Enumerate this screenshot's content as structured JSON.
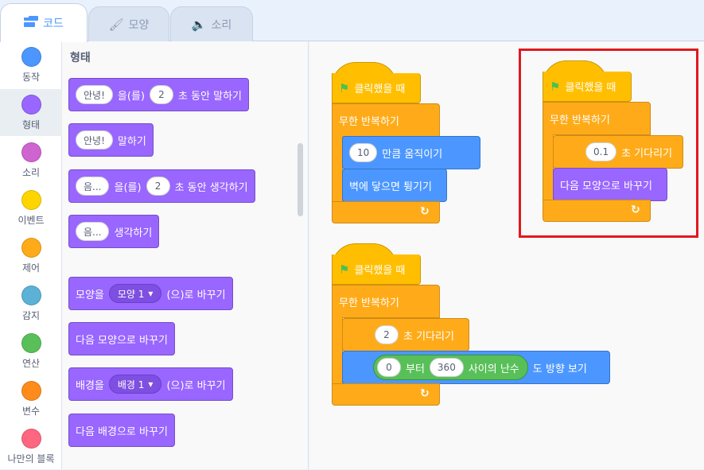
{
  "tabs": [
    {
      "label": "코드",
      "icon": "code-blocks-icon"
    },
    {
      "label": "모양",
      "icon": "paintbrush-icon"
    },
    {
      "label": "소리",
      "icon": "speaker-icon"
    }
  ],
  "categories": [
    {
      "label": "동작",
      "color": "#4c97ff"
    },
    {
      "label": "형태",
      "color": "#9966ff"
    },
    {
      "label": "소리",
      "color": "#cf63cf"
    },
    {
      "label": "이벤트",
      "color": "#ffd500"
    },
    {
      "label": "제어",
      "color": "#ffab19"
    },
    {
      "label": "감지",
      "color": "#5cb1d6"
    },
    {
      "label": "연산",
      "color": "#59c059"
    },
    {
      "label": "변수",
      "color": "#ff8c1a"
    },
    {
      "label": "나만의 블록",
      "color": "#ff6680"
    }
  ],
  "palette": {
    "title": "형태",
    "say_for": {
      "msg": "안녕!",
      "t1": "을(를)",
      "secs": "2",
      "t2": "초 동안 말하기"
    },
    "say": {
      "msg": "안녕!",
      "t1": "말하기"
    },
    "think_for": {
      "msg": "음...",
      "t1": "을(를)",
      "secs": "2",
      "t2": "초 동안 생각하기"
    },
    "think": {
      "msg": "음...",
      "t1": "생각하기"
    },
    "switch_costume": {
      "t1": "모양을",
      "value": "모양 1",
      "t2": "(으)로 바꾸기"
    },
    "next_costume": {
      "t1": "다음 모양으로 바꾸기"
    },
    "switch_backdrop": {
      "t1": "배경을",
      "value": "배경 1",
      "t2": "(으)로 바꾸기"
    },
    "next_backdrop": {
      "t1": "다음 배경으로 바꾸기"
    }
  },
  "scripts": {
    "s1": {
      "hat": "클릭했을 때",
      "forever": "무한 반복하기",
      "move_steps": "10",
      "move_label": "만큼 움직이기",
      "bounce": "벽에 닿으면 튕기기"
    },
    "s2": {
      "hat": "클릭했을 때",
      "forever": "무한 반복하기",
      "wait_secs": "2",
      "wait_label": "초 기다리기",
      "from": "0",
      "from_label": "부터",
      "to": "360",
      "to_label": "사이의 난수",
      "point_label": "도 방향 보기"
    },
    "s3": {
      "hat": "클릭했을 때",
      "forever": "무한 반복하기",
      "wait_secs": "0.1",
      "wait_label": "초 기다리기",
      "next_costume": "다음 모양으로 바꾸기"
    }
  },
  "colors": {
    "highlight": "#e0191f",
    "looks": "#9966ff",
    "motion": "#4c97ff",
    "control": "#ffab19",
    "event": "#ffbf00",
    "operator": "#59c059"
  }
}
